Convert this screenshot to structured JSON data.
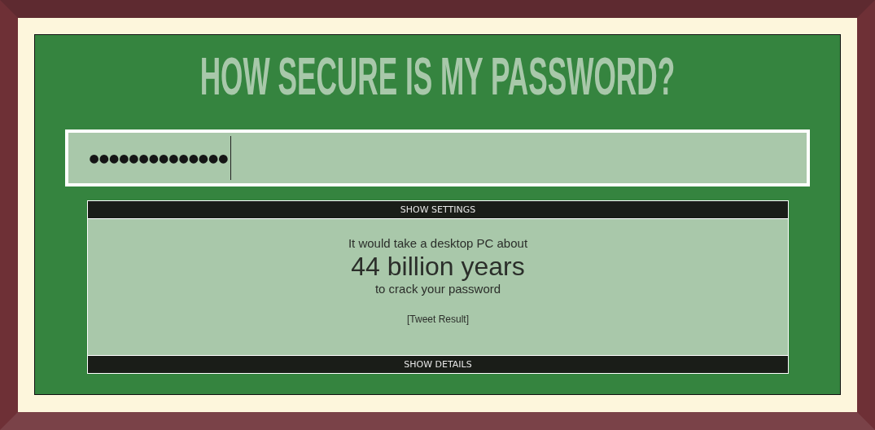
{
  "title": "HOW SECURE IS MY PASSWORD?",
  "password_field": {
    "value": "●●●●●●●●●●●●●●"
  },
  "result": {
    "settings_toggle": "SHOW SETTINGS",
    "lead": "It would take a desktop PC about",
    "time": "44 billion years",
    "tail": "to crack your password",
    "tweet_link": "[Tweet Result]",
    "details_toggle": "SHOW DETAILS"
  }
}
